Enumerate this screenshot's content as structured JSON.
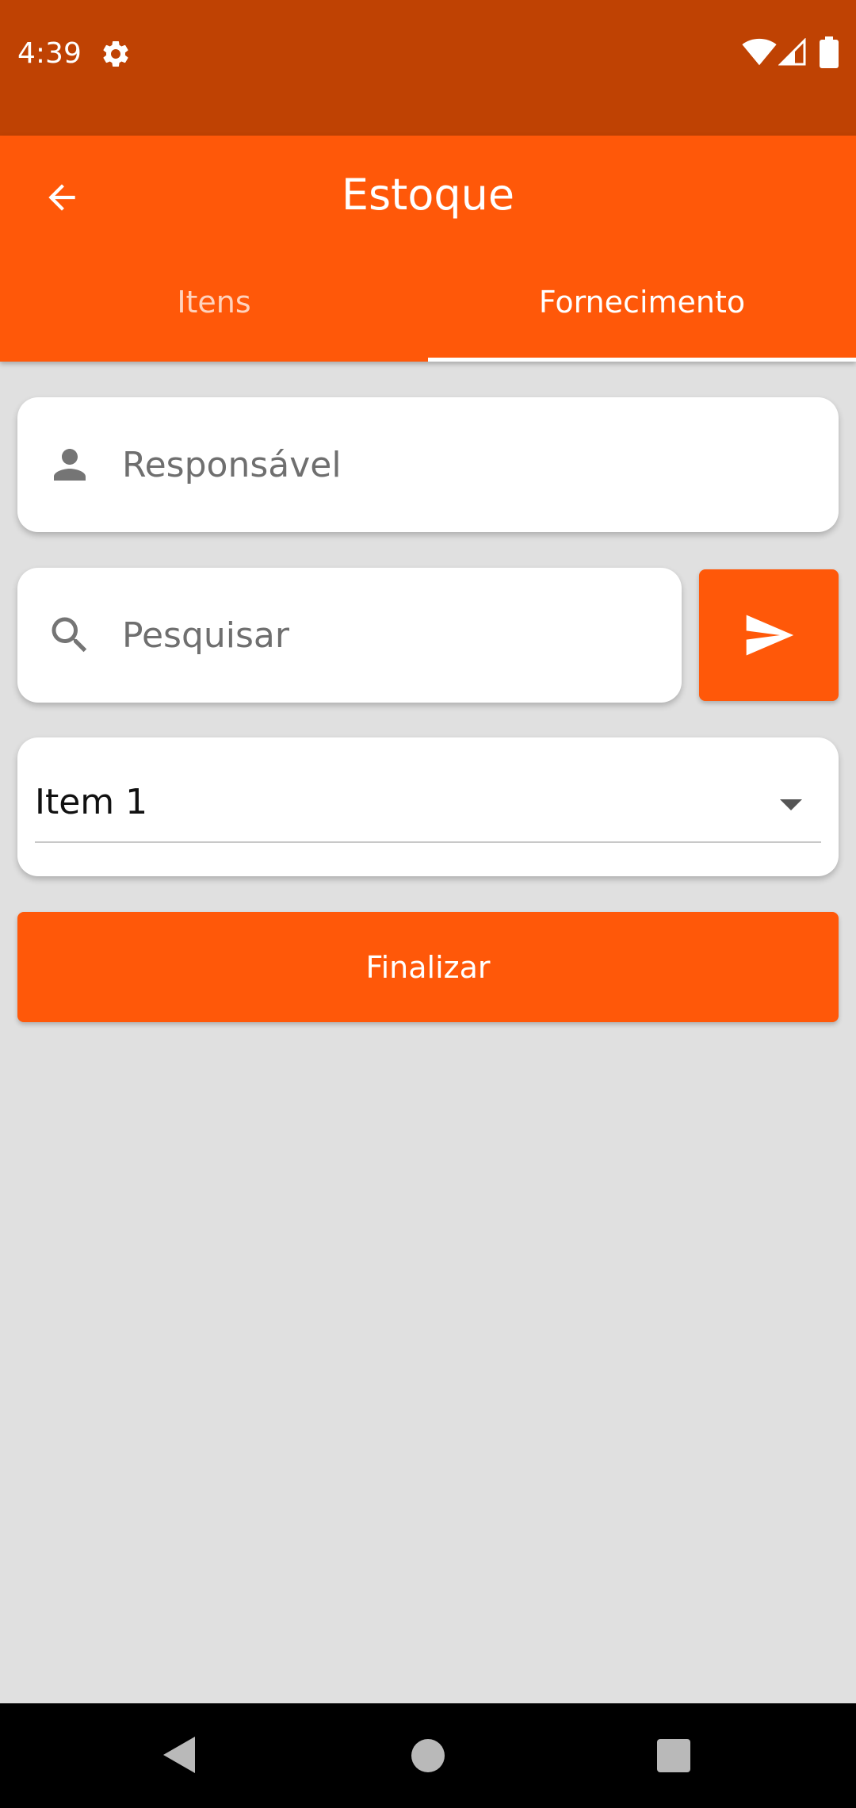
{
  "status_bar": {
    "time": "4:39",
    "icons": [
      "gear-icon",
      "wifi-icon",
      "signal-icon",
      "battery-icon"
    ]
  },
  "app_bar": {
    "title": "Estoque",
    "back_icon": "arrow-back-icon",
    "tabs": [
      {
        "label": "Itens",
        "selected": false
      },
      {
        "label": "Fornecimento",
        "selected": true
      }
    ]
  },
  "form": {
    "responsavel": {
      "placeholder": "Responsável",
      "value": "",
      "icon": "person-icon"
    },
    "pesquisar": {
      "placeholder": "Pesquisar",
      "value": "",
      "icon": "search-icon"
    },
    "send_icon": "send-icon",
    "item_select": {
      "selected": "Item 1"
    },
    "finalize_label": "Finalizar"
  },
  "nav_bar": {
    "icons": [
      "nav-back-icon",
      "nav-home-icon",
      "nav-recents-icon"
    ]
  },
  "colors": {
    "status_bar": "#bf4203",
    "primary": "#ff5809",
    "background": "#e0e0e0"
  }
}
